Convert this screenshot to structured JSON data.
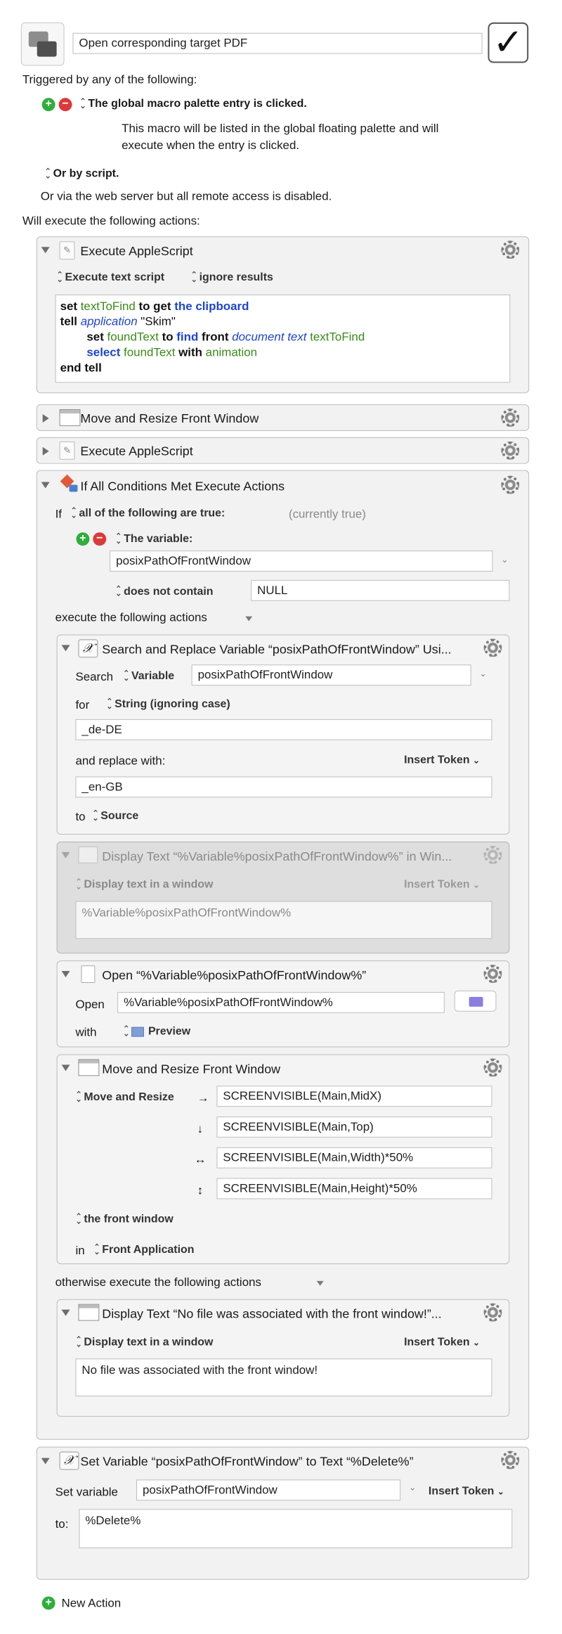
{
  "macro": {
    "name": "Open corresponding target PDF",
    "enabled_check": "✓"
  },
  "triggers": {
    "heading": "Triggered by any of the following:",
    "palette_trigger": "The global macro palette entry is clicked.",
    "palette_desc_1": "This macro will be listed in the global floating palette and will",
    "palette_desc_2": "execute when the entry is clicked.",
    "script_trigger": "Or by script.",
    "web_note": "Or via the web server but all remote access is disabled."
  },
  "actions_heading": "Will execute the following actions:",
  "a1": {
    "title": "Execute AppleScript",
    "mode": "Execute text script",
    "result": "ignore results",
    "code": {
      "l1_set": "set",
      "l1_var": "textToFind",
      "l1_to": "to get",
      "l1_cb": "the clipboard",
      "l2_tell": "tell",
      "l2_app": "application",
      "l2_name": "\"Skim\"",
      "l3_set": "set",
      "l3_var": "foundText",
      "l3_to": "to",
      "l3_find": "find",
      "l3_front": "front",
      "l3_doc": "document text",
      "l3_arg": "textToFind",
      "l4_select": "select",
      "l4_var": "foundText",
      "l4_with": "with",
      "l4_anim": "animation",
      "l5_end": "end tell"
    }
  },
  "a2": {
    "title": "Move and Resize Front Window"
  },
  "a3": {
    "title": "Execute AppleScript"
  },
  "a4": {
    "title": "If All Conditions Met Execute Actions",
    "if_label": "If",
    "match": "all of the following are true:",
    "status": "(currently true)",
    "cond_type": "The variable:",
    "cond_var": "posixPathOfFrontWindow",
    "cond_op": "does not contain",
    "cond_value": "NULL",
    "then_label": "execute the following actions",
    "else_label": "otherwise execute the following actions"
  },
  "s1": {
    "title": "Search and Replace Variable “posixPathOfFrontWindow” Usi...",
    "search_label": "Search",
    "search_type": "Variable",
    "search_var": "posixPathOfFrontWindow",
    "for_label": "for",
    "for_type": "String (ignoring case)",
    "find_value": "_de-DE",
    "replace_label": "and replace with:",
    "insert_token": "Insert Token",
    "replace_value": "_en-GB",
    "to_label": "to",
    "to_value": "Source"
  },
  "s2": {
    "title": "Display Text “%Variable%posixPathOfFrontWindow%” in Win...",
    "mode": "Display text in a window",
    "insert_token": "Insert Token",
    "text": "%Variable%posixPathOfFrontWindow%"
  },
  "s3": {
    "title": "Open “%Variable%posixPathOfFrontWindow%”",
    "open_label": "Open",
    "path": "%Variable%posixPathOfFrontWindow%",
    "with_label": "with",
    "app": "Preview"
  },
  "s4": {
    "title": "Move and Resize Front Window",
    "mode": "Move and Resize",
    "x_arrow": "→",
    "x": "SCREENVISIBLE(Main,MidX)",
    "y_arrow": "↓",
    "y": "SCREENVISIBLE(Main,Top)",
    "w_arrow": "↔",
    "w": "SCREENVISIBLE(Main,Width)*50%",
    "h_arrow": "↕",
    "h": "SCREENVISIBLE(Main,Height)*50%",
    "target": "the front window",
    "in_label": "in",
    "app": "Front Application"
  },
  "s5": {
    "title": "Display Text “No file was associated with the front window!”...",
    "mode": "Display text in a window",
    "insert_token": "Insert Token",
    "text": "No file was associated with the front window!"
  },
  "a5": {
    "title": "Set Variable “posixPathOfFrontWindow” to Text “%Delete%”",
    "set_label": "Set variable",
    "var": "posixPathOfFrontWindow",
    "insert_token": "Insert Token",
    "to_label": "to:",
    "value": "%Delete%"
  },
  "new_action": "New Action",
  "colors": {
    "add": "#2fae3b",
    "remove": "#dc3a3a",
    "keyword_blue": "#1e45d0",
    "var_green": "#3a8a1a"
  }
}
